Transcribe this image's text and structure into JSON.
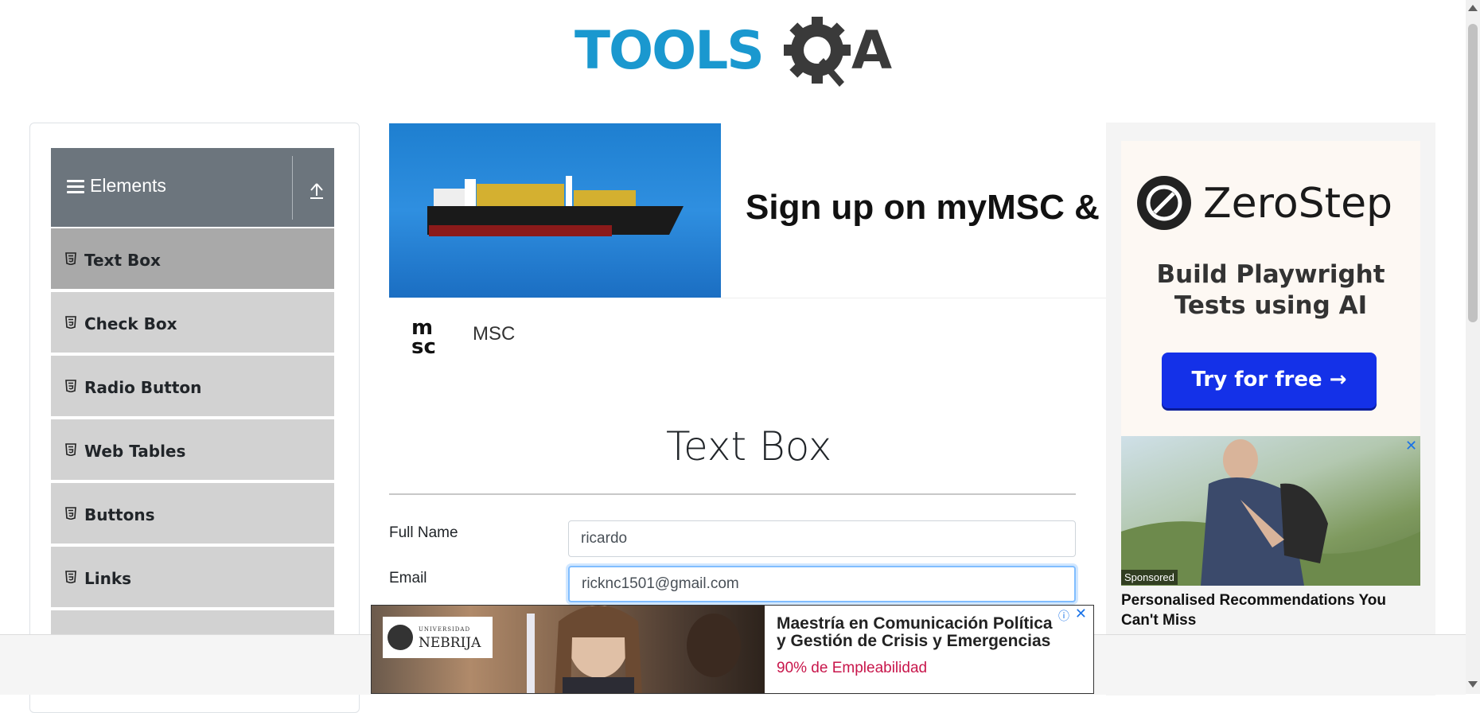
{
  "logo": {
    "part1": "TOOLS",
    "part2": "QA",
    "colors": {
      "tools": "#1a98cf",
      "qa": "#3a3a3a"
    }
  },
  "sidebar": {
    "group_title": "Elements",
    "items": [
      {
        "label": "Text Box",
        "active": true
      },
      {
        "label": "Check Box"
      },
      {
        "label": "Radio Button"
      },
      {
        "label": "Web Tables"
      },
      {
        "label": "Buttons"
      },
      {
        "label": "Links"
      }
    ]
  },
  "banner_ad": {
    "headline": "Sign up on myMSC & B",
    "advertiser": "MSC"
  },
  "form": {
    "title": "Text Box",
    "full_name": {
      "label": "Full Name",
      "value": "ricardo"
    },
    "email": {
      "label": "Email",
      "value": "ricknc1501@gmail.com"
    }
  },
  "right_ad": {
    "brand": "ZeroStep",
    "tagline_line1": "Build Playwright",
    "tagline_line2": "Tests using AI",
    "cta": "Try for free →",
    "sponsored": "Sponsored",
    "close": "✕",
    "recommendation": "Personalised Recommendations You Can't Miss"
  },
  "bottom_ad": {
    "logo_small": "UNIVERSIDAD",
    "logo_name": "NEBRIJA",
    "title_line1": "Maestría en Comunicación Política",
    "title_line2": "y Gestión de Crisis y Emergencias",
    "subtitle": "90% de Empleabilidad",
    "info": "ⓘ",
    "close": "✕"
  }
}
